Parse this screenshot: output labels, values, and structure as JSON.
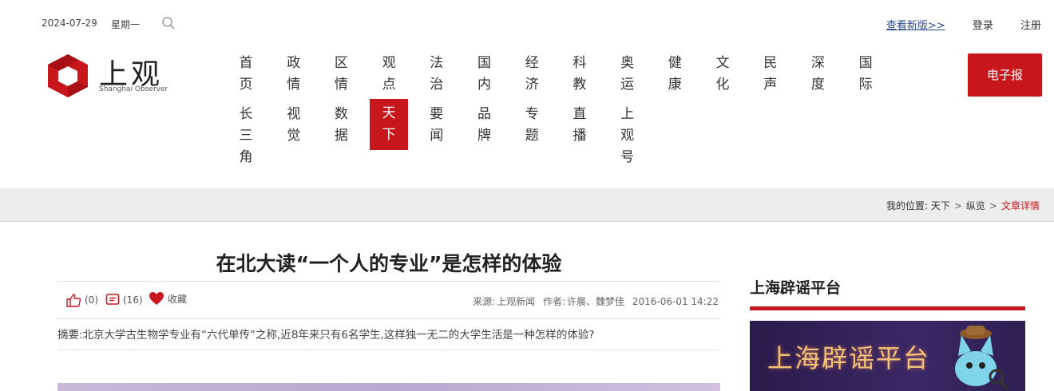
{
  "top": {
    "date": "2024-07-29",
    "weekday": "星期一",
    "new_version": "查看新版>>",
    "login": "登录",
    "register": "注册"
  },
  "logo": {
    "cn": "上观",
    "en": "Shanghai Observer"
  },
  "nav": {
    "row1": [
      "首页",
      "政情",
      "区情",
      "观点",
      "法治",
      "国内",
      "经济",
      "科教",
      "奥运",
      "健康",
      "文化",
      "民声",
      "深度",
      "国际"
    ],
    "row2": [
      "长三角",
      "视觉",
      "数据",
      "天下",
      "要闻",
      "品牌",
      "专题",
      "直播",
      "上观号"
    ],
    "active": "天下",
    "epaper": "电子报"
  },
  "breadcrumb": {
    "label": "我的位置:",
    "items": [
      "天下",
      "纵览",
      "文章详情"
    ]
  },
  "article": {
    "title": "在北大读“一个人的专业”是怎样的体验",
    "likes": "(0)",
    "comments": "(16)",
    "favorite": "收藏",
    "source_label": "来源:",
    "source": "上观新闻",
    "author_label": "作者:",
    "authors": "许晨、魏梦佳",
    "datetime": "2016-06-01 14:22",
    "summary": "摘要:北京大学古生物学专业有“六代单传”之称,近8年来只有6名学生,这样独一无二的大学生活是一种怎样的体验?"
  },
  "sidebar": {
    "title": "上海辟谣平台",
    "banner_text": "上海辟谣平台"
  },
  "colors": {
    "brand_red": "#c8161d",
    "link_blue": "#2b4b8c",
    "band_gray": "#ededed"
  }
}
